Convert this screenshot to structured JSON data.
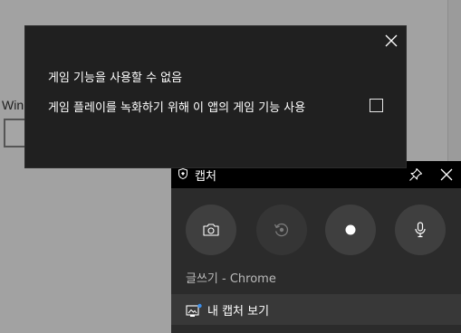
{
  "background": {
    "partial_label": "Win"
  },
  "notice": {
    "title": "게임 기능을 사용할 수 없음",
    "option_label": "게임 플레이를 녹화하기 위해 이 앱의 게임 기능 사용",
    "option_checked": false,
    "close_icon": "close-icon"
  },
  "capture": {
    "title": "캡처",
    "pin_icon": "pin-icon",
    "close_icon": "close-icon",
    "buttons": [
      {
        "name": "screenshot",
        "icon": "camera-icon"
      },
      {
        "name": "record-last",
        "icon": "replay-icon",
        "disabled": true
      },
      {
        "name": "start-recording",
        "icon": "record-dot-icon"
      },
      {
        "name": "microphone",
        "icon": "microphone-icon"
      }
    ],
    "source_label": "글쓰기 - Chrome",
    "view_captures_label": "내 캡처 보기",
    "colors": {
      "widget_bg": "#2b2b2b",
      "titlebar_bg": "#000000",
      "button_bg": "#3f3f3f",
      "accent": "#3b8eea"
    }
  }
}
